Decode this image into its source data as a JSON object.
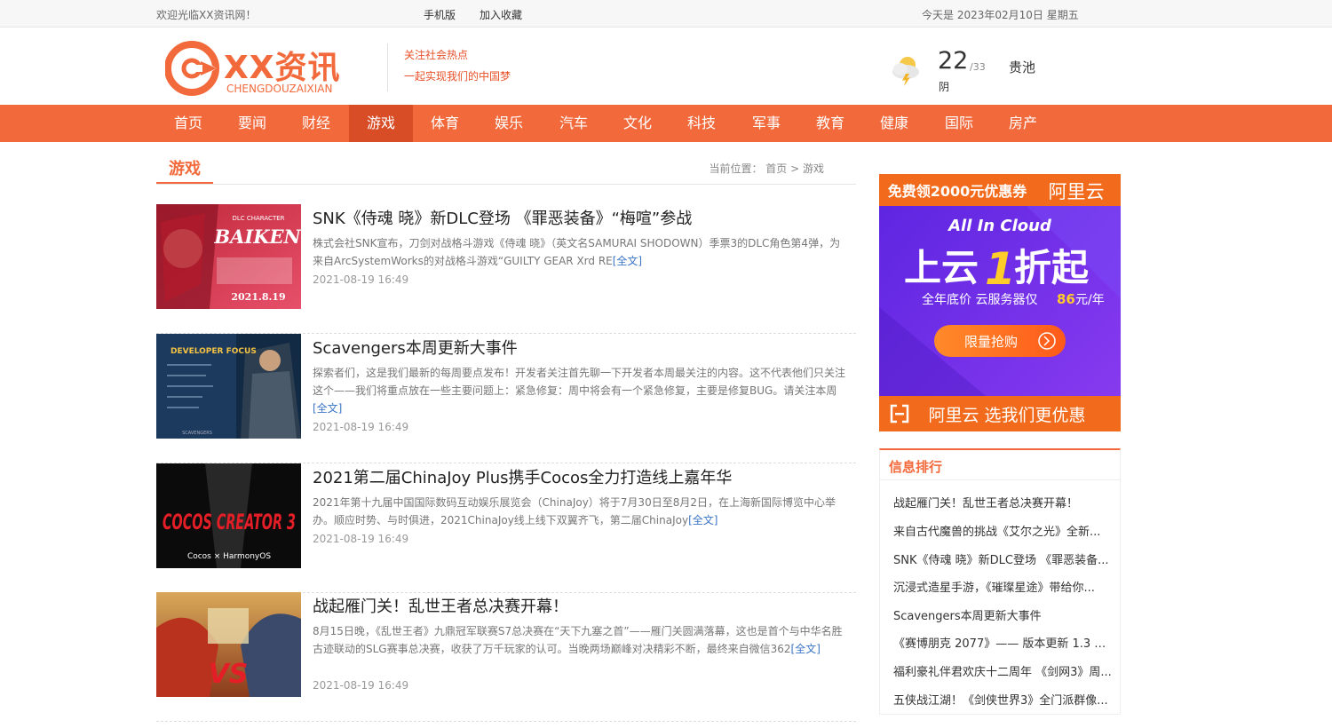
{
  "topbar": {
    "welcome": "欢迎光临XX资讯网！",
    "mobile": "手机版",
    "favorite": "加入收藏",
    "date": "今天是 2023年02月10日 星期五"
  },
  "header": {
    "logo_text": "XX资讯",
    "logo_sub": "CHENGDOUZAIXIAN",
    "slogan_line1": "关注社会热点",
    "slogan_line2": "一起实现我们的中国梦",
    "weather": {
      "temp": "22",
      "high": "/33",
      "condition": "阴",
      "city": "贵池",
      "icon": "cloud-lightning-icon"
    }
  },
  "nav": {
    "items": [
      {
        "label": "首页"
      },
      {
        "label": "要闻"
      },
      {
        "label": "财经"
      },
      {
        "label": "游戏"
      },
      {
        "label": "体育"
      },
      {
        "label": "娱乐"
      },
      {
        "label": "汽车"
      },
      {
        "label": "文化"
      },
      {
        "label": "科技"
      },
      {
        "label": "军事"
      },
      {
        "label": "教育"
      },
      {
        "label": "健康"
      },
      {
        "label": "国际"
      },
      {
        "label": "房产"
      }
    ],
    "active_index": 3
  },
  "section": {
    "name": "游戏",
    "crumb_prefix": "当前位置：",
    "crumb_home": "首页",
    "crumb_sep": " > ",
    "crumb_current": "游戏"
  },
  "articles": [
    {
      "title": "SNK《侍魂 晓》新DLC登场 《罪恶装备》“梅喧”参战",
      "desc": "株式会社SNK宣布，刀剑对战格斗游戏《侍魂 晓》（英文名SAMURAI SHODOWN）季票3的DLC角色第4弹，为来自ArcSystemWorks的对战格斗游戏“GUILTY GEAR Xrd RE",
      "more": "[全文]",
      "date": "2021-08-19 16:49",
      "thumb_text": "BAIKEN",
      "thumb_sub": "DLC CHARACTER",
      "thumb_date": "2021.8.19"
    },
    {
      "title": "Scavengers本周更新大事件",
      "desc": "探索者们，这是我们最新的每周要点发布！开发者关注首先聊一下开发者本周最关注的内容。这不代表他们只关注这个——我们将重点放在一些主要问题上：紧急修复：周中将会有一个紧急修复，主要是修复BUG。请关注本周",
      "more": "[全文]",
      "date": "2021-08-19 16:49",
      "thumb_text": "DEVELOPER FOCUS",
      "thumb_sub": "SCAVENGERS"
    },
    {
      "title": "2021第二届ChinaJoy Plus携手Cocos全力打造线上嘉年华",
      "desc": "2021年第十九届中国国际数码互动娱乐展览会（ChinaJoy）将于7月30日至8月2日，在上海新国际博览中心举办。顺应时势、与时俱进，2021ChinaJoy线上线下双翼齐飞，第二届ChinaJoy",
      "more": "[全文]",
      "date": "2021-08-19 16:49",
      "thumb_text": "COCOS CREATOR 3",
      "thumb_sub": "Cocos × HarmonyOS"
    },
    {
      "title": "战起雁门关！乱世王者总决赛开幕！",
      "desc": "8月15日晚，《乱世王者》九鼎冠军联赛S7总决赛在“天下九塞之首”——雁门关圆满落幕，这也是首个与中华名胜古迹联动的SLG赛事总决赛，收获了万千玩家的认可。当晚两场巅峰对决精彩不断，最终来自微信362",
      "more": "[全文]",
      "date": "2021-08-19 16:49",
      "thumb_text": "VS"
    }
  ],
  "ad": {
    "top_text": "免费领2000元优惠券",
    "brand": "阿里云",
    "tagline": "All In Cloud",
    "headline_a": "上云",
    "headline_b": "1",
    "headline_c": "折起",
    "sub": "全年底价 云服务器仅",
    "price": "86",
    "unit": "元/年",
    "button": "限量抢购",
    "bottom": "阿里云 选我们更优惠",
    "colors": {
      "purple": "#6a2ee8",
      "orange": "#f26a1b"
    }
  },
  "ranking": {
    "title": "信息排行",
    "items": [
      "战起雁门关！乱世王者总决赛开幕！",
      "来自古代魔兽的挑战《艾尔之光》全新...",
      "SNK《侍魂 晓》新DLC登场 《罪恶装备...",
      "沉浸式造星手游，《璀璨星途》带给你...",
      "Scavengers本周更新大事件",
      "《赛博朋克 2077》—— 版本更新 1.3 带...",
      "福利豪礼伴君欢庆十二周年 《剑网3》周...",
      "五侠战江湖！《剑侠世界3》全门派群像..."
    ]
  }
}
